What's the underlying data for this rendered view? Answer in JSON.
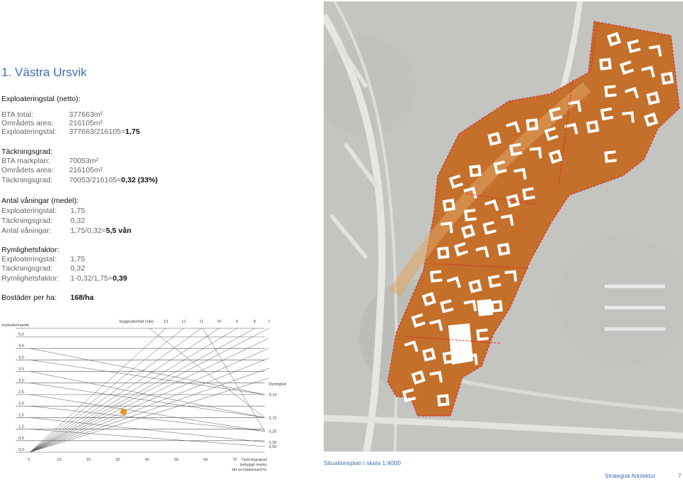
{
  "title": "1. Västra Ursvik",
  "expl": {
    "heading": "Exploateringstal (netto):",
    "rows": [
      {
        "label": "BTA total:",
        "value": "377663m²"
      },
      {
        "label": "Områdets area:",
        "value": "216105m²"
      },
      {
        "label": "Exploateringstal:",
        "value": "377663/216105=",
        "bold": "1,75"
      }
    ]
  },
  "tack": {
    "heading": "Täckningsgrad:",
    "rows": [
      {
        "label": "BTA markplan:",
        "value": "70053m²"
      },
      {
        "label": "Områdets area:",
        "value": "216105m²"
      },
      {
        "label": "Täckningsgrad:",
        "value": "70053/216105=",
        "bold": "0,32 (33%)"
      }
    ]
  },
  "van": {
    "heading": "Antal våningar (medel):",
    "rows": [
      {
        "label": "Exploateringstal:",
        "value": "1,75"
      },
      {
        "label": "Täckningsgrad:",
        "value": "0,32"
      },
      {
        "label": "Antal våningar:",
        "value": "1,75/0,32=",
        "bold": "5,5 vån"
      }
    ]
  },
  "rym": {
    "heading": "Rymlighetsfaktor:",
    "rows": [
      {
        "label": "Exploateringstal:",
        "value": "1,75"
      },
      {
        "label": "Täckningsgrad:",
        "value": "0,32"
      },
      {
        "label": "Rymlighetsfaktor:",
        "value": "1-0,32/1,75=",
        "bold": "0,39"
      }
    ]
  },
  "bostader": {
    "label": "Bostäder per ha:",
    "value": "168/ha"
  },
  "chart_data": {
    "type": "scatter",
    "ylabel": "exploateringstal",
    "xlabel_lines": [
      "Täckningsgrad",
      "bebyggd marks",
      "del av totalarean(%)"
    ],
    "y_ticks": [
      "5,0",
      "4,5",
      "4,0",
      "3,5",
      "3,0",
      "2,5",
      "2,0",
      "1,5",
      "1,0",
      "0,5",
      "0,0"
    ],
    "x_ticks": [
      "0",
      "10",
      "20",
      "30",
      "40",
      "50",
      "60",
      "70"
    ],
    "floors_label": "byggnadshöjd (vån)",
    "floors_ticks": [
      "13",
      "12",
      "11",
      "10",
      "9",
      "8",
      "7"
    ],
    "rym_label": "Rymlighet",
    "rym_ticks": [
      "0,10",
      "0,15",
      "0,25",
      "0,35",
      "0,50"
    ],
    "point": {
      "x": 32,
      "y": 1.75
    },
    "point_color": "#f39221"
  },
  "map": {
    "caption": "Situationsplan i skala 1:4000"
  },
  "footer": {
    "firm": "Strategisk Arkitektur",
    "page": "7"
  }
}
